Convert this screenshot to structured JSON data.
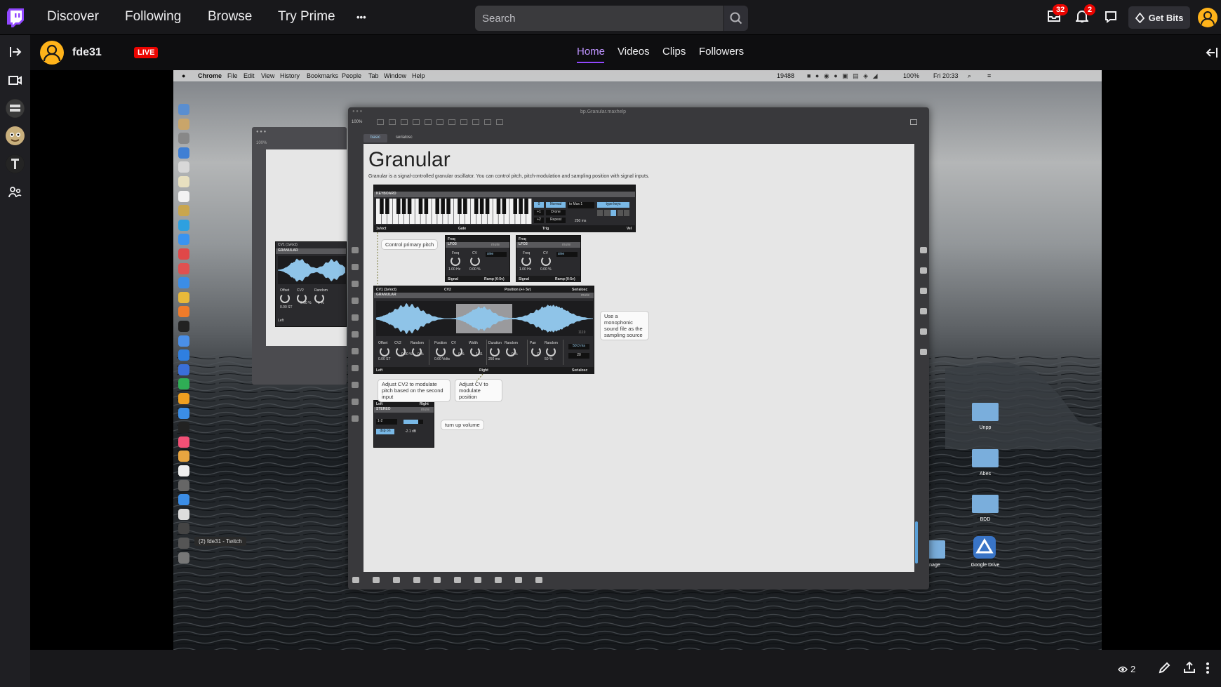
{
  "topnav": {
    "links": [
      "Discover",
      "Following",
      "Browse",
      "Try Prime"
    ],
    "more_label": "•••",
    "search_placeholder": "Search",
    "inbox_badge": "32",
    "notif_badge": "2",
    "get_bits_label": "Get Bits"
  },
  "channel": {
    "name": "fde31",
    "live_label": "LIVE",
    "tabs": [
      "Home",
      "Videos",
      "Clips",
      "Followers"
    ],
    "active_tab": "Home"
  },
  "mac_menubar": {
    "app": "Chrome",
    "items": [
      "File",
      "Edit",
      "View",
      "History",
      "Bookmarks",
      "People",
      "Tab",
      "Window",
      "Help"
    ],
    "counter": "19488",
    "battery": "100%",
    "clock": "Fri 20:33"
  },
  "max_window": {
    "title": "bp.Granular.maxhelp",
    "zoom": "100%",
    "back_zoom": "100%",
    "tabs": [
      "basic",
      "serialosc"
    ],
    "heading": "Granular",
    "description": "Granular is a signal-controlled granular oscillator. You can control pitch, pitch-modulation and sampling position with signal inputs.",
    "keyboard": {
      "title": "KEYBOARD",
      "octaves": [
        "0",
        "+1",
        "+2"
      ],
      "modes": [
        "Normal",
        "Drone",
        "Repeat"
      ],
      "target": "to Max 1",
      "time": "250 ms",
      "type_keys": "type keys",
      "outs": [
        "1v/oct",
        "Gate",
        "Trig",
        "Vel"
      ]
    },
    "lfo": {
      "in": "Freq",
      "title": "LFO3",
      "mute": "mute",
      "knob_labels": [
        "Freq",
        "CV"
      ],
      "values": [
        "1.00 Hz",
        "0.00 %"
      ],
      "wave": "sine",
      "outs": [
        "Signal",
        "Ramp (0-5v)"
      ]
    },
    "granular": {
      "inputs": [
        "CV1 (1v/oct)",
        "CV2",
        "Position (+/- 5v)",
        "Serialosc"
      ],
      "title": "GRANULAR",
      "mute": "mute",
      "knobs": [
        {
          "label": "Offset",
          "value": "0.00 ST"
        },
        {
          "label": "CV2",
          "value": "0.00 %"
        },
        {
          "label": "Random",
          "value": "0 %"
        },
        {
          "label": "Position",
          "value": "0.00 Volts"
        },
        {
          "label": "CV",
          "value": "0 %"
        },
        {
          "label": "Width",
          "value": "1.31"
        },
        {
          "label": "Duration",
          "value": "250 ms"
        },
        {
          "label": "Random",
          "value": "0 %"
        },
        {
          "label": "Pan",
          "value": "C"
        },
        {
          "label": "Random",
          "value": "50 %"
        }
      ],
      "length": "50.0 ms",
      "grains": "20",
      "corner": "1119",
      "outs": [
        "Left",
        "Right",
        "Serialosc"
      ]
    },
    "stereo": {
      "ins": [
        "Left",
        "Right"
      ],
      "title": "STEREO",
      "mute": "mute",
      "channels": "1-2",
      "dsp": "dsp on",
      "level": "-2.1 dB"
    },
    "comments": {
      "pitch": "Control primary pitch",
      "sound": "Use a monophonic sound file as the sampling source",
      "cv2": "Adjust CV2 to modulate pitch based on the second input",
      "cv": "Adjust CV to modulate position",
      "volume": "turn up volume"
    }
  },
  "back_window": {
    "inputs": "CV1 (1v/oct)",
    "title": "GRANULAR",
    "knob_labels": [
      "Offset",
      "CV2",
      "Random"
    ],
    "values": [
      "0.00 ST",
      "0.00 %",
      "0 %"
    ],
    "out": "Left"
  },
  "desktop": {
    "folders": [
      "Unpp",
      "Abes",
      "BDD",
      "Tunage"
    ],
    "drive_label": "Google Drive",
    "tooltip": "(2) fde31 - Twitch"
  },
  "player": {
    "viewer_count": "2"
  },
  "colors": {
    "twitch_purple": "#9147ff",
    "live_red": "#eb0400",
    "wave_blue": "#8fc4e8"
  }
}
